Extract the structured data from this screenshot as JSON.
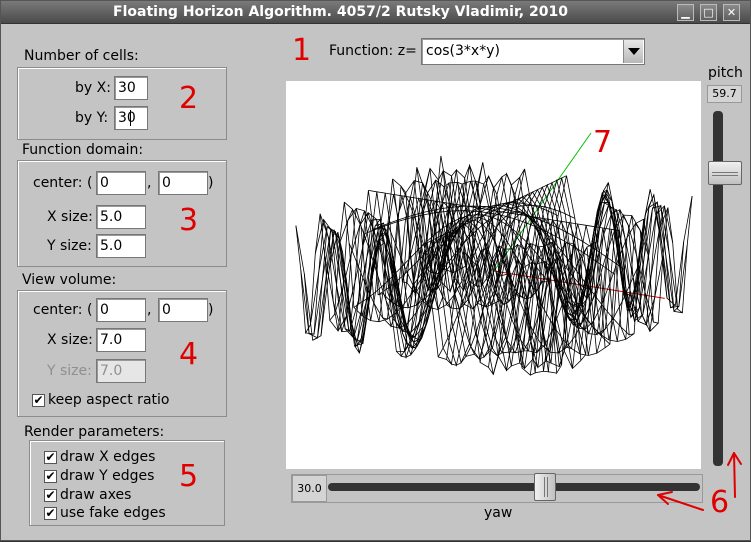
{
  "window": {
    "title": "Floating Horizon Algorithm. 4057/2  Rutsky Vladimir, 2010",
    "minimize": "▁",
    "maximize": "□",
    "close": "✕"
  },
  "cells": {
    "title": "Number of cells:",
    "by_x_label": "by X:",
    "by_x_value": "30",
    "by_y_label": "by Y:",
    "by_y_value": "30"
  },
  "domain": {
    "title": "Function domain:",
    "center_label": "center: (",
    "center_x": "0",
    "comma": ",",
    "center_y": "0",
    "close_paren": ")",
    "x_size_label": "X size:",
    "x_size": "5.0",
    "y_size_label": "Y size:",
    "y_size": "5.0"
  },
  "view": {
    "title": "View volume:",
    "center_label": "center: (",
    "center_x": "0",
    "comma": ",",
    "center_y": "0",
    "close_paren": ")",
    "x_size_label": "X size:",
    "x_size": "7.0",
    "y_size_label": "Y size:",
    "y_size": "7.0",
    "keep_aspect_label": "keep aspect ratio",
    "keep_aspect": true
  },
  "render": {
    "title": "Render parameters:",
    "options": [
      {
        "label": "draw X edges",
        "checked": true
      },
      {
        "label": "draw Y edges",
        "checked": true
      },
      {
        "label": "draw axes",
        "checked": true
      },
      {
        "label": "use fake edges",
        "checked": true
      }
    ]
  },
  "function": {
    "label": "Function: z=",
    "value": "cos(3*x*y)"
  },
  "pitch": {
    "label": "pitch",
    "value": "59.7"
  },
  "yaw": {
    "label": "yaw",
    "value": "30.0"
  },
  "annotations": [
    "1",
    "2",
    "3",
    "4",
    "5",
    "6",
    "7"
  ],
  "colors": {
    "annotation": "#e00000",
    "background": "#c4c4c4",
    "mesh": "#000000",
    "axis_red": "#e00000",
    "axis_green": "#00c000",
    "hidden_edges": "#c0004a"
  }
}
